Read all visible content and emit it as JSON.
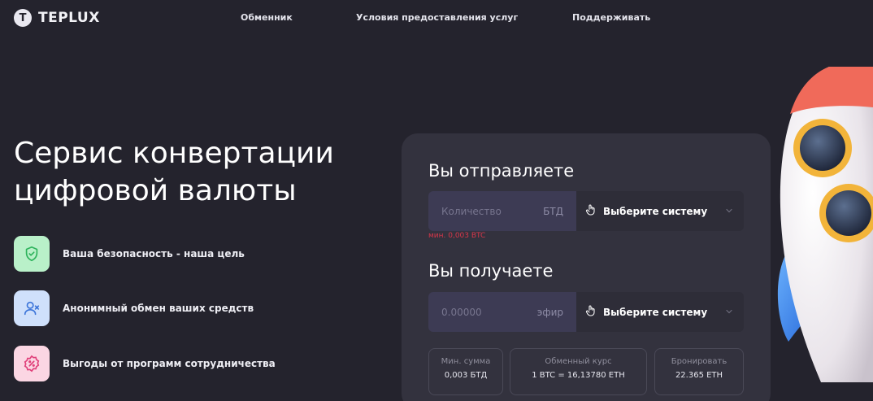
{
  "header": {
    "logo_letter": "T",
    "logo_text": "TEPLUX",
    "nav": [
      "Обменник",
      "Условия предоставления услуг",
      "Поддерживать"
    ]
  },
  "hero": {
    "title_line1": "Сервис конвертации",
    "title_line2": "цифровой валюты",
    "features": [
      {
        "label": "Ваша безопасность - наша цель",
        "icon": "shield-check-icon",
        "bg": "#b9f0c9",
        "fg": "#2eb35c"
      },
      {
        "label": "Анонимный обмен ваших средств",
        "icon": "user-x-icon",
        "bg": "#cfe0fb",
        "fg": "#3b74d9"
      },
      {
        "label": "Выгоды от программ сотрудничества",
        "icon": "percent-badge-icon",
        "bg": "#fbd6e3",
        "fg": "#e0407a"
      }
    ]
  },
  "exchange": {
    "send_heading": "Вы отправляете",
    "send_placeholder": "Количество",
    "send_unit": "БТД",
    "send_select": "Выберите систему",
    "min_note": "мин. 0,003 BTC",
    "receive_heading": "Вы получаете",
    "receive_placeholder": "0.00000",
    "receive_unit": "эфир",
    "receive_select": "Выберите систему",
    "stats": [
      {
        "label": "Мин. сумма",
        "value": "0,003 БТД"
      },
      {
        "label": "Обменный курс",
        "value": "1 BTC = 16,13780 ETH"
      },
      {
        "label": "Бронировать",
        "value": "22.365 ETH"
      }
    ]
  },
  "colors": {
    "background": "#24232d",
    "card": "#33323e",
    "input": "#3d3b54",
    "error": "#d9364a"
  }
}
